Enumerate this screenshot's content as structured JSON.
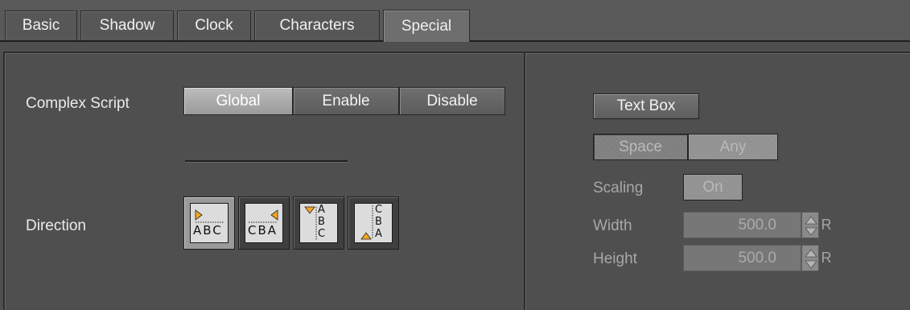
{
  "tabs": [
    {
      "label": "Basic",
      "active": false
    },
    {
      "label": "Shadow",
      "active": false
    },
    {
      "label": "Clock",
      "active": false
    },
    {
      "label": "Characters",
      "active": false
    },
    {
      "label": "Special",
      "active": true
    }
  ],
  "left_panel": {
    "complex_script": {
      "label": "Complex Script",
      "options": [
        "Global",
        "Enable",
        "Disable"
      ],
      "selected": "Global"
    },
    "direction": {
      "label": "Direction",
      "options": [
        {
          "name": "left-to-right",
          "text": "ABC",
          "selected": true
        },
        {
          "name": "right-to-left",
          "text": "CBA",
          "selected": false
        },
        {
          "name": "top-to-bottom",
          "text": "ABC",
          "selected": false
        },
        {
          "name": "bottom-to-top",
          "text": "CBA",
          "selected": false
        }
      ]
    }
  },
  "right_panel": {
    "text_box_label": "Text Box",
    "wrap_options": [
      "Space",
      "Any"
    ],
    "wrap_selected": "Space",
    "scaling": {
      "label": "Scaling",
      "value": "On"
    },
    "width": {
      "label": "Width",
      "value": "500.0",
      "reset_label": "R"
    },
    "height": {
      "label": "Height",
      "value": "500.0",
      "reset_label": "R"
    }
  },
  "colors": {
    "background": "#4f4f4f",
    "accent_arrow": "#f5a623"
  }
}
